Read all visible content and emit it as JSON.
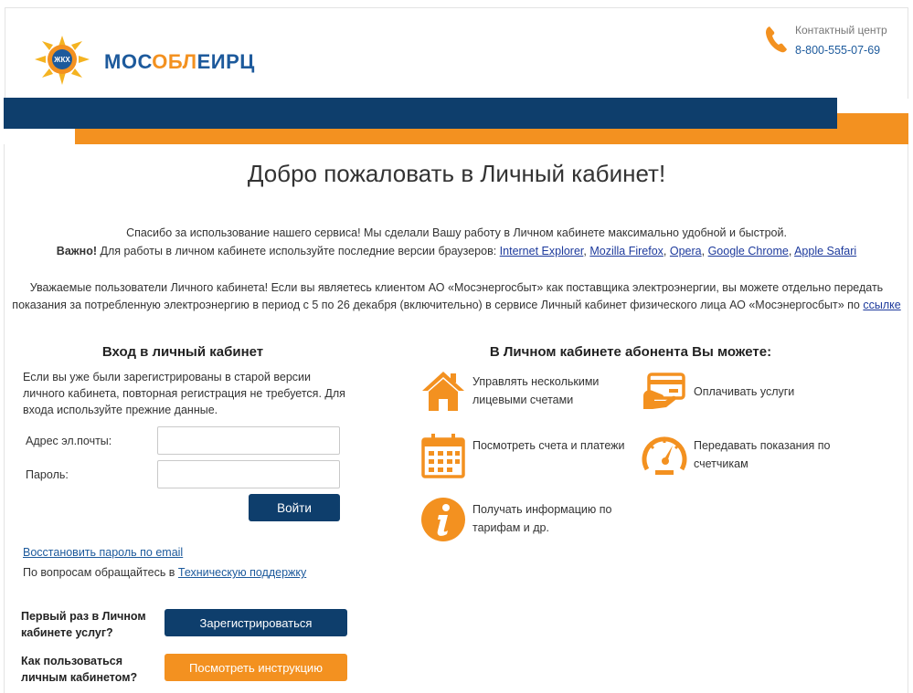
{
  "header": {
    "logo_badge": "ЖКХ",
    "logo_text_part1": "МОС",
    "logo_text_part2": "ОБЛ",
    "logo_text_part3": "ЕИРЦ",
    "contact_title": "Контактный центр",
    "contact_phone": "8-800-555-07-69"
  },
  "colors": {
    "brand_blue": "#0e3e6c",
    "brand_orange": "#f39120",
    "link_blue": "#1d5a9c"
  },
  "welcome": {
    "title": "Добро пожаловать в Личный кабинет!",
    "thanks": "Спасибо за использование нашего сервиса! Мы сделали Вашу работу в Личном кабинете максимально удобной и быстрой.",
    "important_label": "Важно!",
    "important_text": " Для работы в личном кабинете используйте последние версии браузеров: ",
    "browsers": [
      "Internet Explorer",
      "Mozilla Firefox",
      "Opera",
      "Google Chrome",
      "Apple Safari"
    ],
    "notice": "Уважаемые пользователи Личного кабинета! Если вы являетесь клиентом АО «Мосэнергосбыт» как поставщика электроэнергии, вы можете отдельно передать показания за потребленную электроэнергию в период с 5 по 26 декабря (включительно) в сервисе Личный кабинет физического лица АО «Мосэнергосбыт» по ",
    "notice_link": "ссылке"
  },
  "login": {
    "title": "Вход в личный кабинет",
    "info": "Если вы уже были зарегистрированы в старой версии личного кабинета, повторная регистрация не требуется. Для входа используйте прежние данные.",
    "email_label": "Адрес эл.почты:",
    "email_value": "",
    "password_label": "Пароль:",
    "password_value": "",
    "submit_label": "Войти",
    "restore_link": "Восстановить пароль по email",
    "support_text": "По вопросам обращайтесь в ",
    "support_link": "Техническую поддержку",
    "first_time_label": "Первый раз в Личном кабинете услуг?",
    "register_label": "Зарегистрироваться",
    "howto_label": "Как пользоваться личным кабинетом?",
    "instruction_label": "Посмотреть инструкцию"
  },
  "features": {
    "title": "В Личном кабинете абонента Вы можете:",
    "items": [
      {
        "icon": "house-icon",
        "label": "Управлять несколькими лицевыми счетами"
      },
      {
        "icon": "card-payment-icon",
        "label": "Оплачивать услуги"
      },
      {
        "icon": "calendar-icon",
        "label": "Посмотреть счета и платежи"
      },
      {
        "icon": "meter-gauge-icon",
        "label": "Передавать показания по счетчикам"
      },
      {
        "icon": "info-icon",
        "label": "Получать информацию по тарифам и др."
      }
    ]
  }
}
